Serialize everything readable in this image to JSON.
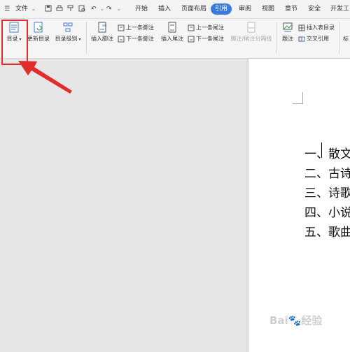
{
  "titlebar": {
    "menu_label": "文件",
    "tabs": [
      "开始",
      "插入",
      "页面布局",
      "引用",
      "审阅",
      "视图",
      "章节",
      "安全",
      "开发工"
    ],
    "active_tab": "引用"
  },
  "ribbon": {
    "toc_label": "目录",
    "update_toc_label": "更新目录",
    "toc_level_label": "目录级别",
    "insert_footnote_label": "插入脚注",
    "prev_footnote_label": "上一条脚注",
    "next_footnote_label": "下一条脚注",
    "insert_endnote_label": "插入尾注",
    "prev_endnote_label": "上一条尾注",
    "next_endnote_label": "下一条尾注",
    "separator_label": "脚注/尾注分隔线",
    "caption_label": "题注",
    "insert_table_toc_label": "插入表目录",
    "cross_ref_label": "交叉引用",
    "more_label": "标"
  },
  "document": {
    "lines": [
      "一、散文",
      "二、古诗",
      "三、诗歌",
      "四、小说",
      "五、歌曲"
    ]
  },
  "watermark": "Bai🐾经验",
  "colors": {
    "accent": "#3a7be0",
    "highlight": "#e02d2d"
  }
}
